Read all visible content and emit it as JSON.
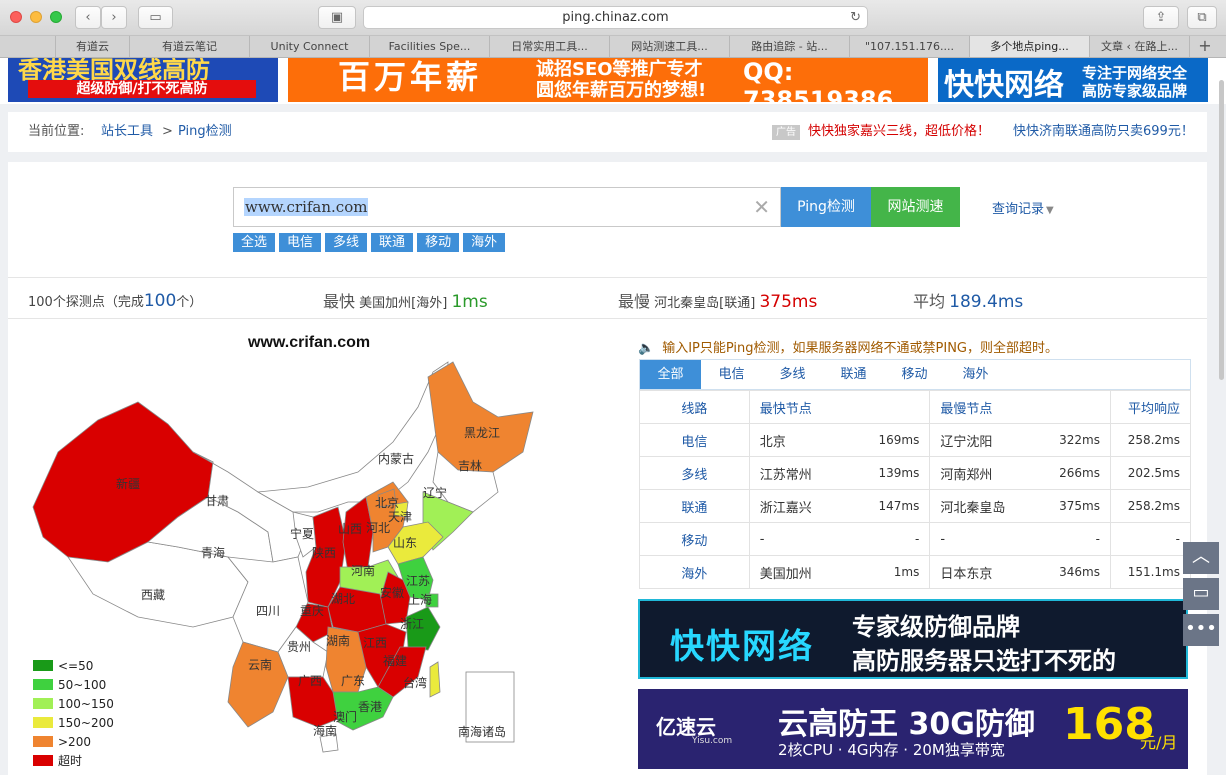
{
  "browser": {
    "url": "ping.chinaz.com",
    "tabs": [
      "有道云",
      "有道云笔记",
      "Unity Connect",
      "Facilities Spe...",
      "日常实用工具...",
      "网站测速工具...",
      "路由追踪 - 站...",
      "\"107.151.176....",
      "多个地点ping...",
      "文章 ‹ 在路上..."
    ],
    "active_tab": 8
  },
  "ads": {
    "ad1_title": "香港美国双线高防",
    "ad1_sub": "超级防御/打不死高防",
    "ad2_big": "百万年薪",
    "ad2_line1": "诚招SEO等推广专才",
    "ad2_line2": "圆您年薪百万的梦想!",
    "ad2_qq": "QQ: 738519386",
    "ad3_brand": "快快网络",
    "ad3_line1": "专注于网络安全",
    "ad3_line2": "高防专家级品牌",
    "ad4_brand": "快快网络",
    "ad4_line1": "专家级防御品牌",
    "ad4_line2": "高防服务器只选打不死的",
    "ad5_logo": "亿速云",
    "ad5_sub": "Yisu.com",
    "ad5_title": "云高防王 30G防御",
    "ad5_spec": "2核CPU · 4G内存 · 20M独享带宽",
    "ad5_price": "168",
    "ad5_unit": "元/月",
    "ad_tag": "广告"
  },
  "breadcrumb": {
    "label": "当前位置:",
    "item1": "站长工具",
    "sep": ">",
    "item2": "Ping检测",
    "promo1": "快快独家嘉兴三线，超低价格！",
    "promo2": "快快济南联通高防只卖699元！"
  },
  "search": {
    "value": "www.crifan.com",
    "ping_label": "Ping检测",
    "speed_label": "网站测速",
    "history_label": "查询记录",
    "filters": [
      "全选",
      "电信",
      "多线",
      "联通",
      "移动",
      "海外"
    ]
  },
  "stats": {
    "points_prefix": "100个探测点（完成",
    "points_done": "100",
    "points_suffix": "个）",
    "fastest_label": "最快",
    "fastest_loc": "美国加州[海外]",
    "fastest_val": "1ms",
    "slowest_label": "最慢",
    "slowest_loc": "河北秦皇岛[联通]",
    "slowest_val": "375ms",
    "avg_label": "平均",
    "avg_val": "189.4ms"
  },
  "map": {
    "title": "www.crifan.com",
    "colors": {
      "le50": "#199a18",
      "r50_100": "#3fd13f",
      "r100_150": "#a1f056",
      "r150_200": "#eaea3c",
      "gt200": "#ef8430",
      "timeout": "#d90000",
      "none": "#ffffff"
    },
    "legend": [
      "<=50",
      "50~100",
      "100~150",
      "150~200",
      ">200",
      "超时"
    ],
    "labels": {
      "heilongjiang": "黑龙江",
      "jilin": "吉林",
      "liaoning": "辽宁",
      "neimenggu": "内蒙古",
      "beijing": "北京",
      "tianjin": "天津",
      "hebei": "河北",
      "shandong": "山东",
      "gansu": "甘肃",
      "xinjiang": "新疆",
      "qinghai": "青海",
      "ningxia": "宁夏",
      "shanxi1": "山西",
      "shaanxi": "陕西",
      "henan": "河南",
      "jiangsu": "江苏",
      "anhui": "安徽",
      "shanghai": "上海",
      "xizang": "西藏",
      "sichuan": "四川",
      "chongqing": "重庆",
      "hubei": "湖北",
      "zhejiang": "浙江",
      "guizhou": "贵州",
      "hunan": "湖南",
      "jiangxi": "江西",
      "fujian": "福建",
      "yunnan": "云南",
      "guangxi": "广西",
      "guangdong": "广东",
      "taiwan": "台湾",
      "xianggang": "香港",
      "aomen": "澳门",
      "hainan": "海南",
      "nanhai": "南海诸岛"
    }
  },
  "right": {
    "notice": "输入IP只能Ping检测，如果服务器网络不通或禁PING，则全部超时。",
    "tabs": [
      "全部",
      "电信",
      "多线",
      "联通",
      "移动",
      "海外"
    ],
    "headers": [
      "线路",
      "最快节点",
      "最慢节点",
      "平均响应"
    ],
    "rows": [
      {
        "line": "电信",
        "fast": "北京",
        "fast_ms": "169ms",
        "slow": "辽宁沈阳",
        "slow_ms": "322ms",
        "avg": "258.2ms"
      },
      {
        "line": "多线",
        "fast": "江苏常州",
        "fast_ms": "139ms",
        "slow": "河南郑州",
        "slow_ms": "266ms",
        "avg": "202.5ms"
      },
      {
        "line": "联通",
        "fast": "浙江嘉兴",
        "fast_ms": "147ms",
        "slow": "河北秦皇岛",
        "slow_ms": "375ms",
        "avg": "258.2ms"
      },
      {
        "line": "移动",
        "fast": "-",
        "fast_ms": "-",
        "slow": "-",
        "slow_ms": "-",
        "avg": "-"
      },
      {
        "line": "海外",
        "fast": "美国加州",
        "fast_ms": "1ms",
        "slow": "日本东京",
        "slow_ms": "346ms",
        "avg": "151.1ms"
      }
    ]
  }
}
